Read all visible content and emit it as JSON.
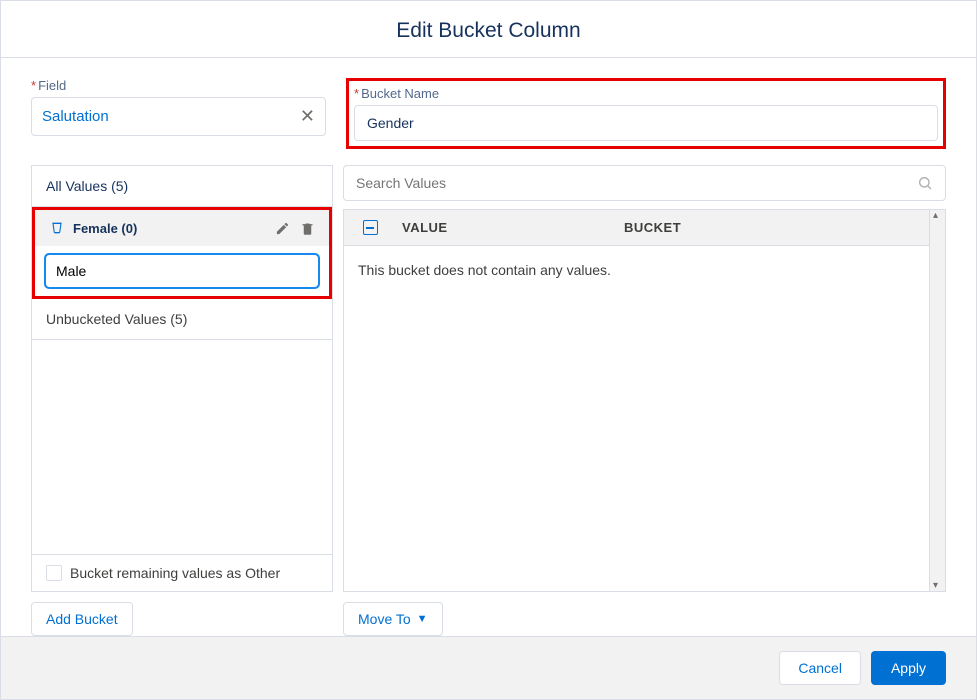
{
  "header": {
    "title": "Edit Bucket Column"
  },
  "field": {
    "label": "Field",
    "value": "Salutation"
  },
  "bucketName": {
    "label": "Bucket Name",
    "value": "Gender"
  },
  "bucketList": {
    "all": "All Values (5)",
    "selected": "Female (0)",
    "editValue": "Male",
    "unbucketed": "Unbucketed Values (5)"
  },
  "otherCheckbox": "Bucket remaining values as Other",
  "addBucket": "Add Bucket",
  "search": {
    "placeholder": "Search Values"
  },
  "tableHeaders": {
    "value": "VALUE",
    "bucket": "BUCKET"
  },
  "emptyMessage": "This bucket does not contain any values.",
  "moveTo": "Move To",
  "footer": {
    "cancel": "Cancel",
    "apply": "Apply"
  }
}
